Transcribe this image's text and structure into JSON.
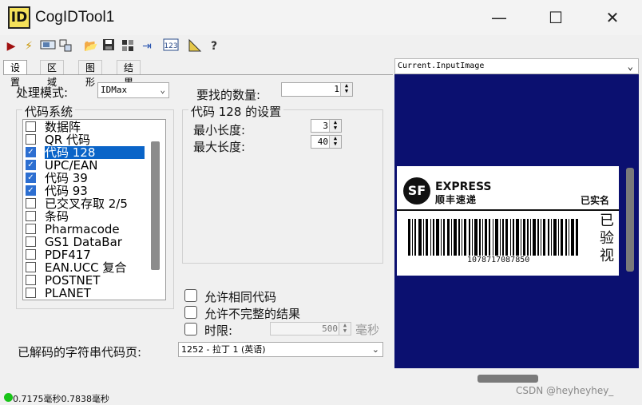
{
  "window": {
    "title": "CogIDTool1",
    "icon_text": "ID"
  },
  "window_controls": {
    "minimize": "—",
    "maximize": "☐",
    "close": "✕"
  },
  "tabs": [
    "设置",
    "区域",
    "图形",
    "结果"
  ],
  "settings": {
    "mode_label": "处理模式:",
    "mode_value": "IDMax",
    "count_label": "要找的数量:",
    "count_value": "1",
    "code_system_label": "代码系统",
    "codes": [
      {
        "label": "数据阵",
        "checked": false
      },
      {
        "label": "QR 代码",
        "checked": false
      },
      {
        "label": "代码 128",
        "checked": true,
        "selected": true
      },
      {
        "label": "UPC/EAN",
        "checked": true
      },
      {
        "label": "代码 39",
        "checked": true
      },
      {
        "label": "代码 93",
        "checked": true
      },
      {
        "label": "已交叉存取 2/5",
        "checked": false
      },
      {
        "label": "条码",
        "checked": false
      },
      {
        "label": "Pharmacode",
        "checked": false
      },
      {
        "label": "GS1 DataBar",
        "checked": false
      },
      {
        "label": "PDF417",
        "checked": false
      },
      {
        "label": "EAN.UCC 复合",
        "checked": false
      },
      {
        "label": "POSTNET",
        "checked": false
      },
      {
        "label": "PLANET",
        "checked": false
      }
    ],
    "code128_group_label": "代码 128 的设置",
    "min_length_label": "最小长度:",
    "min_length_value": "3",
    "max_length_label": "最大长度:",
    "max_length_value": "40",
    "allow_same_label": "允许相同代码",
    "allow_incomplete_label": "允许不完整的结果",
    "timeout_label": "时限:",
    "timeout_value": "500",
    "timeout_unit": "毫秒",
    "codepage_label": "已解码的字符串代码页:",
    "codepage_value": "1252 - 拉丁 1 (英语)"
  },
  "image_view": {
    "selector_value": "Current.InputImage",
    "label_brand_en": "EXPRESS",
    "label_brand_cn": "顺丰速递",
    "label_realname": "已实名",
    "label_verified": "已验视",
    "barcode_number": "1078717087850"
  },
  "status": {
    "text": "0.7175毫秒0.7838毫秒",
    "indicator_color": "#18c418"
  },
  "watermark": "CSDN @heyheyhey_",
  "colors": {
    "selection": "#0a64c8",
    "image_bg": "#0b1070"
  }
}
